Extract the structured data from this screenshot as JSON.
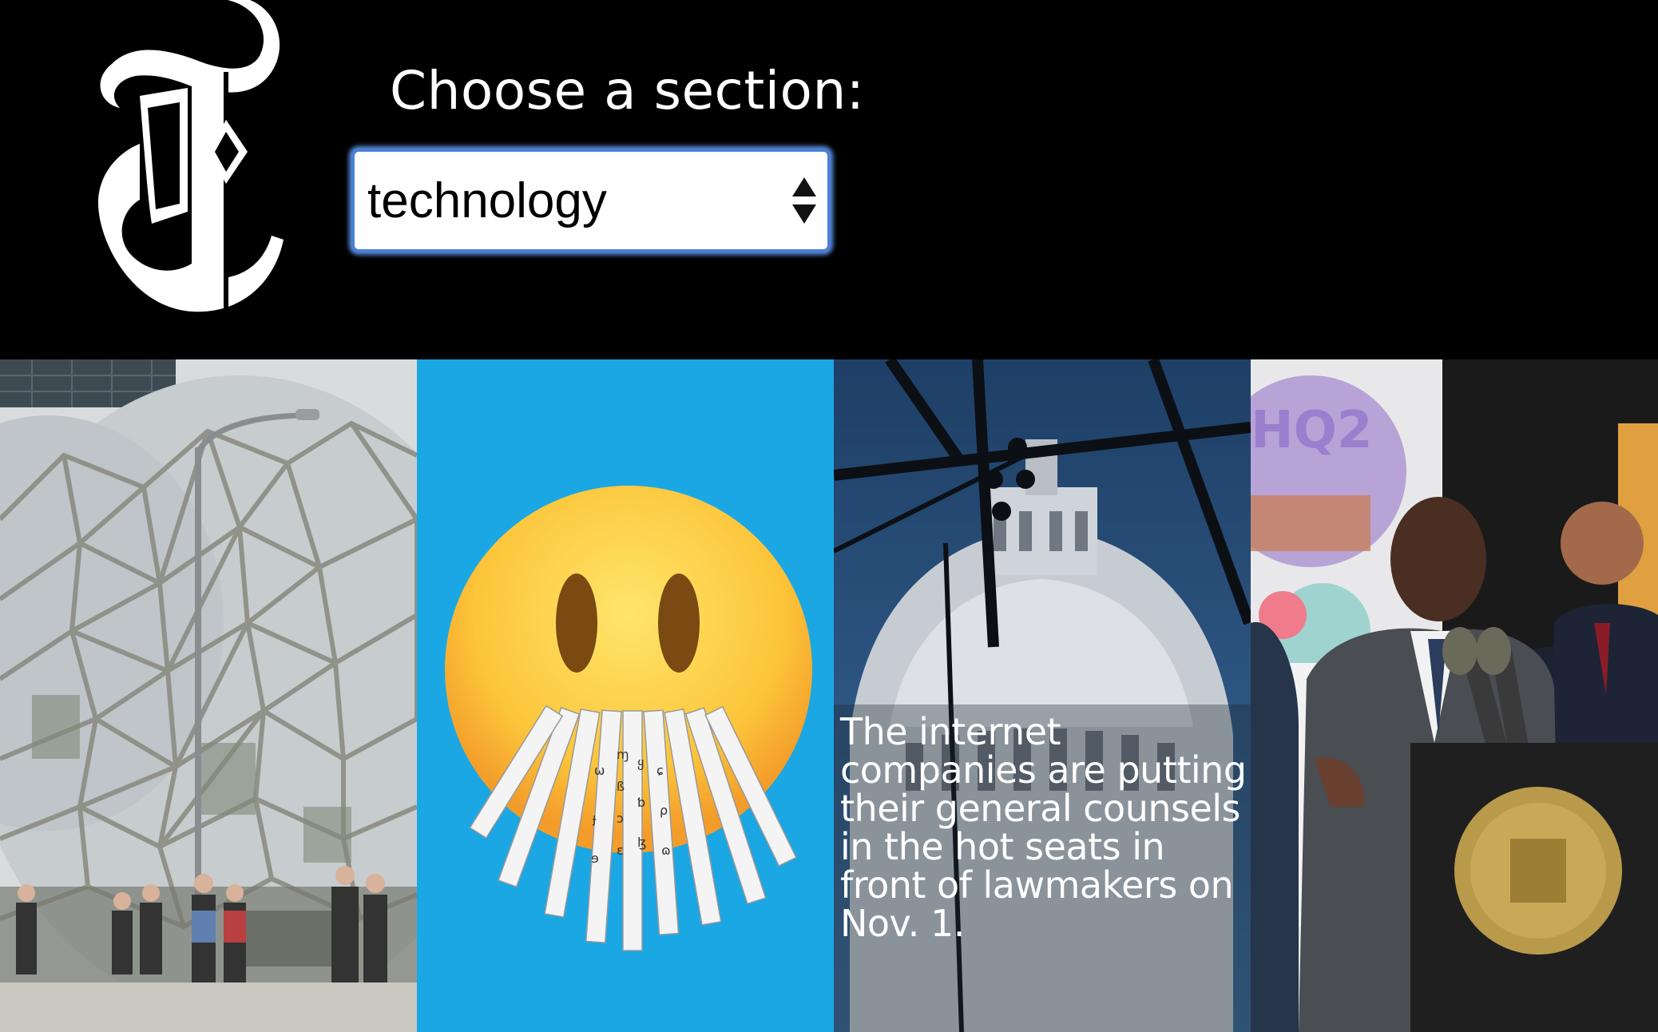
{
  "header": {
    "logo_icon": "nyt-t-logo",
    "section_label": "Choose a section:",
    "section_select": {
      "value": "technology"
    }
  },
  "articles": [
    {
      "image": "amazon-spheres-photo"
    },
    {
      "image": "shredded-paper-emoji-illustration"
    },
    {
      "image": "capitol-dome-photo",
      "caption": "The internet companies are putting their general counsels in the hot seats in front of lawmakers on Nov. 1."
    },
    {
      "image": "press-conference-photo"
    }
  ],
  "colors": {
    "background": "#000000",
    "select_focus": "#4a7fd6",
    "emoji_bg": "#1ba7e4"
  }
}
